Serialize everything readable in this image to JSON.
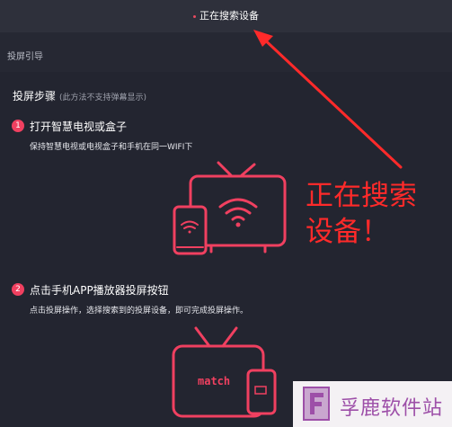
{
  "header": {
    "status_text": "正在搜索设备"
  },
  "guide": {
    "label": "投屏引导"
  },
  "steps": {
    "title": "投屏步骤",
    "note": "(此方法不支持弹幕显示)",
    "items": [
      {
        "number": "1",
        "title": "打开智慧电视或盒子",
        "desc": "保持智慧电视或电视盒子和手机在同一WIFI下"
      },
      {
        "number": "2",
        "title": "点击手机APP播放器投屏按钮",
        "desc": "点击投屏操作，选择搜索到的投屏设备，即可完成投屏操作。"
      }
    ]
  },
  "illustration2": {
    "screen_text": "match"
  },
  "annotation": {
    "line1": "正在搜索",
    "line2": "设备！"
  },
  "watermark": {
    "text": "孚鹿软件站"
  },
  "colors": {
    "accent": "#f04060",
    "annotation": "#ff2a2a",
    "background": "#262833"
  },
  "icons": [
    "wifi-icon",
    "tv-icon",
    "phone-icon",
    "cast-icon"
  ]
}
